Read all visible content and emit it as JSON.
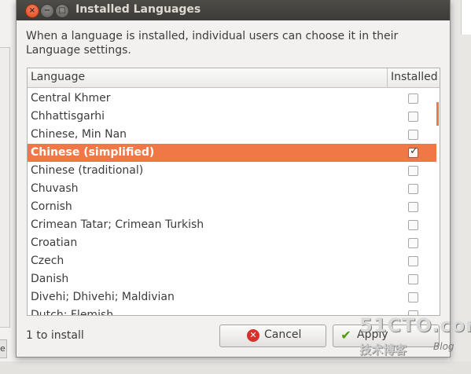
{
  "window": {
    "title": "Installed Languages"
  },
  "description": "When a language is installed, individual users can choose it in their Language settings.",
  "list": {
    "col_language": "Language",
    "col_installed": "Installed",
    "rows": [
      {
        "label": "Central Khmer",
        "installed": false,
        "selected": false
      },
      {
        "label": "Chhattisgarhi",
        "installed": false,
        "selected": false
      },
      {
        "label": "Chinese, Min Nan",
        "installed": false,
        "selected": false
      },
      {
        "label": "Chinese (simplified)",
        "installed": true,
        "selected": true
      },
      {
        "label": "Chinese (traditional)",
        "installed": false,
        "selected": false
      },
      {
        "label": "Chuvash",
        "installed": false,
        "selected": false
      },
      {
        "label": "Cornish",
        "installed": false,
        "selected": false
      },
      {
        "label": "Crimean Tatar; Crimean Turkish",
        "installed": false,
        "selected": false
      },
      {
        "label": "Croatian",
        "installed": false,
        "selected": false
      },
      {
        "label": "Czech",
        "installed": false,
        "selected": false
      },
      {
        "label": "Danish",
        "installed": false,
        "selected": false
      },
      {
        "label": "Divehi; Dhivehi; Maldivian",
        "installed": false,
        "selected": false
      },
      {
        "label": "Dutch; Flemish",
        "installed": false,
        "selected": false
      }
    ]
  },
  "footer": {
    "status": "1 to install",
    "cancel_label": "Cancel",
    "apply_label": "Apply"
  },
  "background": {
    "left_button_label": "e"
  },
  "watermark": {
    "main": "51CTO.com",
    "sub": "技术博客",
    "blog": "Blog"
  },
  "icons": {
    "close": "close-icon",
    "minimize": "minimize-icon",
    "maximize": "maximize-icon",
    "cancel": "cancel-icon",
    "apply": "checkmark-icon"
  },
  "colors": {
    "accent": "#f07746",
    "titlebar": "#3c3b37"
  }
}
